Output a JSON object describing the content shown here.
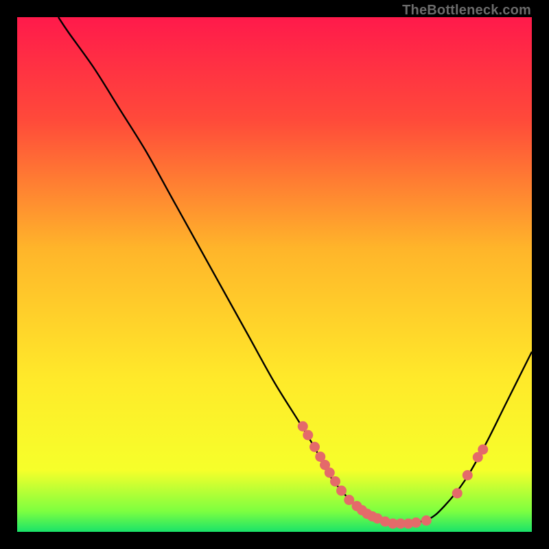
{
  "watermark": "TheBottleneck.com",
  "chart_data": {
    "type": "line",
    "title": "",
    "xlabel": "",
    "ylabel": "",
    "xlim": [
      0,
      100
    ],
    "ylim": [
      0,
      100
    ],
    "gradient_stops": [
      {
        "offset": 0,
        "color": "#ff1a4b"
      },
      {
        "offset": 20,
        "color": "#ff4a3a"
      },
      {
        "offset": 45,
        "color": "#ffb52a"
      },
      {
        "offset": 70,
        "color": "#ffe92a"
      },
      {
        "offset": 88,
        "color": "#f6ff2a"
      },
      {
        "offset": 96,
        "color": "#7dff40"
      },
      {
        "offset": 100,
        "color": "#19e36a"
      }
    ],
    "curve": [
      {
        "x": 8,
        "y": 100
      },
      {
        "x": 10,
        "y": 97
      },
      {
        "x": 15,
        "y": 90
      },
      {
        "x": 20,
        "y": 82
      },
      {
        "x": 25,
        "y": 74
      },
      {
        "x": 30,
        "y": 65
      },
      {
        "x": 35,
        "y": 56
      },
      {
        "x": 40,
        "y": 47
      },
      {
        "x": 45,
        "y": 38
      },
      {
        "x": 50,
        "y": 29
      },
      {
        "x": 55,
        "y": 21
      },
      {
        "x": 58,
        "y": 16
      },
      {
        "x": 60,
        "y": 12
      },
      {
        "x": 63,
        "y": 8
      },
      {
        "x": 66,
        "y": 5
      },
      {
        "x": 70,
        "y": 2.5
      },
      {
        "x": 73,
        "y": 1.6
      },
      {
        "x": 76,
        "y": 1.6
      },
      {
        "x": 80,
        "y": 2.5
      },
      {
        "x": 83,
        "y": 5
      },
      {
        "x": 87,
        "y": 10
      },
      {
        "x": 91,
        "y": 17
      },
      {
        "x": 95,
        "y": 25
      },
      {
        "x": 100,
        "y": 35
      }
    ],
    "marker_color": "#e46a6a",
    "markers": [
      {
        "x": 55.5,
        "y": 20.5
      },
      {
        "x": 56.5,
        "y": 18.8
      },
      {
        "x": 57.8,
        "y": 16.5
      },
      {
        "x": 58.9,
        "y": 14.6
      },
      {
        "x": 59.8,
        "y": 13.0
      },
      {
        "x": 60.7,
        "y": 11.5
      },
      {
        "x": 61.8,
        "y": 9.8
      },
      {
        "x": 63.0,
        "y": 8.0
      },
      {
        "x": 64.5,
        "y": 6.2
      },
      {
        "x": 66.0,
        "y": 5.0
      },
      {
        "x": 67.0,
        "y": 4.2
      },
      {
        "x": 68.0,
        "y": 3.5
      },
      {
        "x": 69.0,
        "y": 3.0
      },
      {
        "x": 70.0,
        "y": 2.6
      },
      {
        "x": 71.5,
        "y": 2.0
      },
      {
        "x": 73.0,
        "y": 1.6
      },
      {
        "x": 74.5,
        "y": 1.6
      },
      {
        "x": 76.0,
        "y": 1.6
      },
      {
        "x": 77.5,
        "y": 1.8
      },
      {
        "x": 79.5,
        "y": 2.2
      },
      {
        "x": 85.5,
        "y": 7.5
      },
      {
        "x": 87.5,
        "y": 11.0
      },
      {
        "x": 89.5,
        "y": 14.5
      },
      {
        "x": 90.5,
        "y": 16.0
      }
    ]
  }
}
